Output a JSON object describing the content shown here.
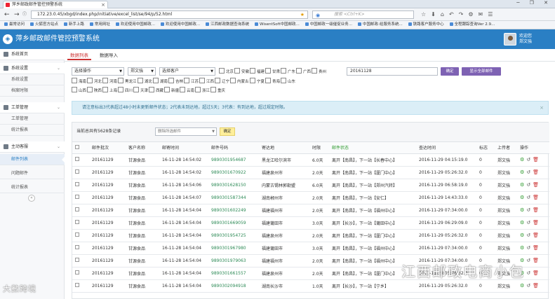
{
  "browser": {
    "tab_title": "萍乡邮政邮件管控预警系统",
    "url": "172.23.0.45/xbgd/index.php/initiative/excel_list/se/94/p/52.html",
    "search_placeholder": "搜索 <Ctrl+K>",
    "bookmarks": [
      "最常访问",
      "火狐官方站点",
      "新手上路",
      "常用网址",
      "欢迎使用中国邮政...",
      "欢迎使用中国邮政...",
      "江西邮政数据查询系统",
      "WisentSoft中国邮政...",
      "中国邮政一级催促业务...",
      "中国邮政-给服务系统...",
      "铁路客户服务中心",
      "全程跟踪查询Ver 2.9..."
    ]
  },
  "header": {
    "title": "萍乡邮政邮件管控预警系统",
    "greeting": "欢迎您",
    "username": "郑文強"
  },
  "sidebar": {
    "items": [
      {
        "label": "系统首页",
        "type": "group"
      },
      {
        "label": "系统设置",
        "type": "group"
      },
      {
        "label": "系统设置",
        "type": "sub"
      },
      {
        "label": "档案时限",
        "type": "sub"
      },
      {
        "label": "工单管理",
        "type": "group"
      },
      {
        "label": "工单管理",
        "type": "sub"
      },
      {
        "label": "统计报表",
        "type": "sub"
      },
      {
        "label": "主动客服",
        "type": "group"
      },
      {
        "label": "邮件列表",
        "type": "sub"
      },
      {
        "label": "问题邮件",
        "type": "sub"
      },
      {
        "label": "统计报表",
        "type": "sub"
      }
    ]
  },
  "tabs": [
    "数据列表",
    "数据导入"
  ],
  "filters": {
    "operation": "选择操作",
    "user": "郑文強",
    "customer": "选择客户",
    "provinces_row1": [
      "北京",
      "安徽",
      "福建",
      "甘肃",
      "广东",
      "广西",
      "贵州"
    ],
    "provinces_row2": [
      "海南",
      "河北",
      "河南",
      "黑龙江",
      "湖北",
      "湖南",
      "吉林",
      "江苏",
      "江西",
      "辽宁",
      "内蒙古",
      "宁夏",
      "青海",
      "山东"
    ],
    "provinces_row3": [
      "山西",
      "陕西",
      "上海",
      "四川",
      "天津",
      "西藏",
      "新疆",
      "云南",
      "浙江",
      "重庆"
    ],
    "date": "20161128",
    "confirm_btn": "确定",
    "show_all_btn": "显示全部邮件"
  },
  "alert": "请注意标出3代表超过48小时未更新邮件状态；2代表未到达地，超过5天；3代表：有到达地，超过规定时限。",
  "list": {
    "total_text": "当前总共有5628条记录",
    "bulk_action": "删除所选邮件",
    "bulk_confirm": "确定",
    "columns": [
      "",
      "邮件批次",
      "客户名称",
      "邮寄时间",
      "邮件号码",
      "寄达地",
      "时限",
      "邮件状态",
      "查达时间",
      "标志",
      "上传者",
      "操作"
    ],
    "rows": [
      [
        "20161129",
        "甘源食品",
        "16-11-28 14:54:02",
        "9890301954687",
        "黑龙江哈尔滨市",
        "6.0天",
        "离开【南昌】，下一站【长春中心】",
        "2016-11-29 04:15:19.0",
        "0",
        "郑文強"
      ],
      [
        "20161129",
        "甘源食品",
        "16-11-28 14:54:02",
        "9890301670922",
        "福建泉州市",
        "2.0天",
        "离开【南昌】，下一站【厦门中心】",
        "2016-11-29 05:26:32.0",
        "0",
        "郑文強"
      ],
      [
        "20161129",
        "甘源食品",
        "16-11-28 14:54:06",
        "9890301628150",
        "内蒙古锡林郭勒盟",
        "6.0天",
        "离开【南昌】，下一站【郑州汽转】",
        "2016-11-29 06:58:19.0",
        "0",
        "郑文強"
      ],
      [
        "20161129",
        "甘源食品",
        "16-11-28 14:54:07",
        "9890301587344",
        "湖南郴州市",
        "2.0天",
        "离开【南昌】，下一站【安仁】",
        "2016-11-29 14:43:33.0",
        "0",
        "郑文強"
      ],
      [
        "20161129",
        "甘源食品",
        "16-11-28 14:54:04",
        "9890301602249",
        "福建福州市",
        "2.0天",
        "离开【南昌】，下一站【福州中心】",
        "2016-11-29 07:34:00.0",
        "0",
        "郑文強"
      ],
      [
        "20161129",
        "甘源食品",
        "16-11-28 14:54:04",
        "9890301669059",
        "福建莆田市",
        "3.0天",
        "离开【长沙】，下一站【莆田中心】",
        "2016-11-29 06:29:09.0",
        "0",
        "郑文強"
      ],
      [
        "20161129",
        "甘源食品",
        "16-11-28 14:54:04",
        "9890301954725",
        "福建泉州市",
        "2.0天",
        "离开【南昌】，下一站【厦门中心】",
        "2016-11-29 05:26:32.0",
        "0",
        "郑文強"
      ],
      [
        "20161129",
        "甘源食品",
        "16-11-28 14:54:04",
        "9890301967980",
        "福建莆田市",
        "3.0天",
        "离开【南昌】，下一站【福州中心】",
        "2016-11-29 07:34:00.0",
        "0",
        "郑文強"
      ],
      [
        "20161129",
        "甘源食品",
        "16-11-28 14:54:04",
        "9890301979063",
        "福建福州市",
        "2.0天",
        "离开【南昌】，下一站【福州中心】",
        "2016-11-29 07:34:00.0",
        "0",
        "郑文強"
      ],
      [
        "20161129",
        "甘源食品",
        "16-11-28 14:54:04",
        "9890301661557",
        "福建泉州市",
        "2.0天",
        "离开【南昌】，下一站【厦门中心】",
        "2016-11-29 05:26:32.0",
        "0",
        "郑文強"
      ],
      [
        "20161129",
        "甘源食品",
        "16-11-28 14:54:04",
        "9890302094918",
        "湖南长沙市",
        "1.0天",
        "离开【长沙】，下一站【宁乡】",
        "2016-11-29 05:26:32.0",
        "0",
        "郑文強"
      ]
    ]
  },
  "watermarks": {
    "left": "大數跨境",
    "right": "江西邮政电商小包"
  },
  "colors": {
    "header": "#2a7fc4",
    "purple_btn": "#7e62b3",
    "code_green": "#2e8b57",
    "status_green": "#2e9a2e"
  }
}
